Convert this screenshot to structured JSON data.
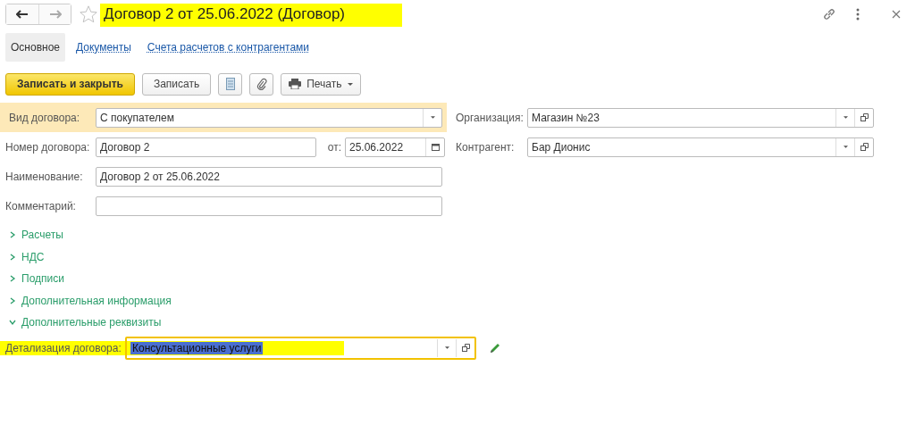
{
  "window": {
    "title": "Договор 2 от 25.06.2022 (Договор)",
    "title_highlighted": true,
    "favorite": false
  },
  "tabs": [
    {
      "label": "Основное",
      "selected": true
    },
    {
      "label": "Документы",
      "selected": false
    },
    {
      "label": "Счета расчетов с контрагентами",
      "selected": false
    }
  ],
  "toolbar": [
    {
      "kind": "primary",
      "label": "Записать и закрыть"
    },
    {
      "kind": "plain",
      "label": "Записать"
    },
    {
      "kind": "list"
    },
    {
      "kind": "attach"
    },
    {
      "kind": "menu",
      "label": "Печать"
    }
  ],
  "rows": [
    {
      "label": "Вид договора:",
      "value": "С покупателем",
      "kind": "dropdown",
      "highlighted": true,
      "right": {
        "label": "Организация:",
        "value": "Магазин №23"
      }
    },
    {
      "label": "Номер договора:",
      "value": "Договор 2",
      "kind": "text-date",
      "date_label": "от:",
      "date": "25.06.2022",
      "highlighted": false,
      "right": {
        "label": "Контрагент:",
        "value": "Бар Дионис"
      }
    },
    {
      "label": "Наименование:",
      "value": "Договор 2 от 25.06.2022",
      "kind": "text",
      "highlighted": false
    },
    {
      "label": "Комментарий:",
      "kind": "text",
      "highlighted": false
    }
  ],
  "groups": [
    {
      "label": "Расчеты",
      "expanded": false
    },
    {
      "label": "НДС",
      "expanded": false
    },
    {
      "label": "Подписи",
      "expanded": false
    },
    {
      "label": "Дополнительная информация",
      "expanded": false
    },
    {
      "label": "Дополнительные реквизиты",
      "expanded": true
    }
  ],
  "detail": {
    "label": "Детализация договора:",
    "value": "Консультационные услуги",
    "selected": true,
    "focused": true,
    "highlighted": true
  }
}
